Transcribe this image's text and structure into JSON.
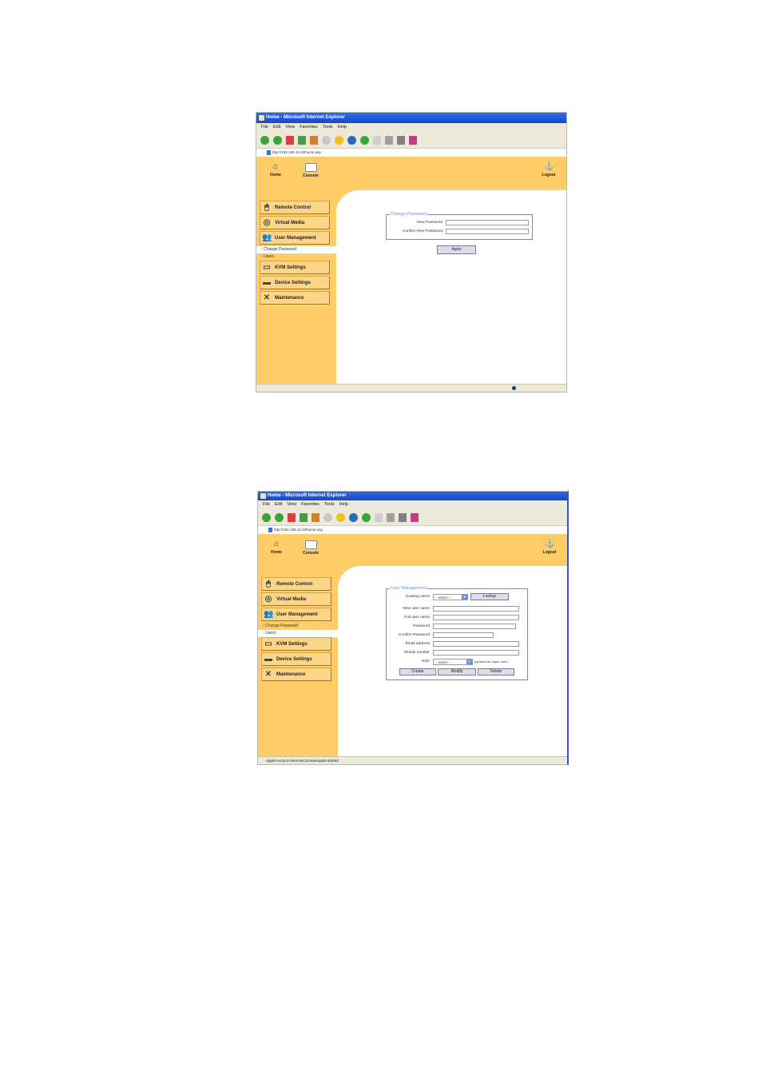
{
  "browser": {
    "title": "Home - Microsoft Internet Explorer",
    "menu": [
      "File",
      "Edit",
      "View",
      "Favorites",
      "Tools",
      "Help"
    ],
    "address": "http://192.168.10.22/home.asp"
  },
  "nav": {
    "home": "Home",
    "console": "Console",
    "logout": "Logout"
  },
  "sidebar": {
    "remote_control": "Remote Control",
    "virtual_media": "Virtual Media",
    "user_management": "User Management",
    "kvm_settings": "KVM Settings",
    "device_settings": "Device Settings",
    "maintenance": "Maintenance",
    "sub_change_password": "Change Password",
    "sub_users": "Users"
  },
  "screen1": {
    "legend": "Change Password",
    "new_password_label": "New Password",
    "confirm_password_label": "Confirm New Password",
    "apply_label": "Apply"
  },
  "screen2": {
    "legend": "User Management",
    "existing_users_label": "Existing users",
    "existing_users_value": "-- select --",
    "lookup_label": "Lookup",
    "new_user_name_label": "New user name",
    "full_user_name_label": "Full user name",
    "password_label": "Password",
    "confirm_password_label": "Confirm Password",
    "email_label": "Email address",
    "mobile_label": "Mobile number",
    "role_label": "Role",
    "role_value": "-- select --",
    "role_note": "(ignored for super user)",
    "create_label": "Create",
    "modify_label": "Modify",
    "delete_label": "Delete",
    "status": "Applet vscrp.in.RemoteConsoleApplet started"
  }
}
